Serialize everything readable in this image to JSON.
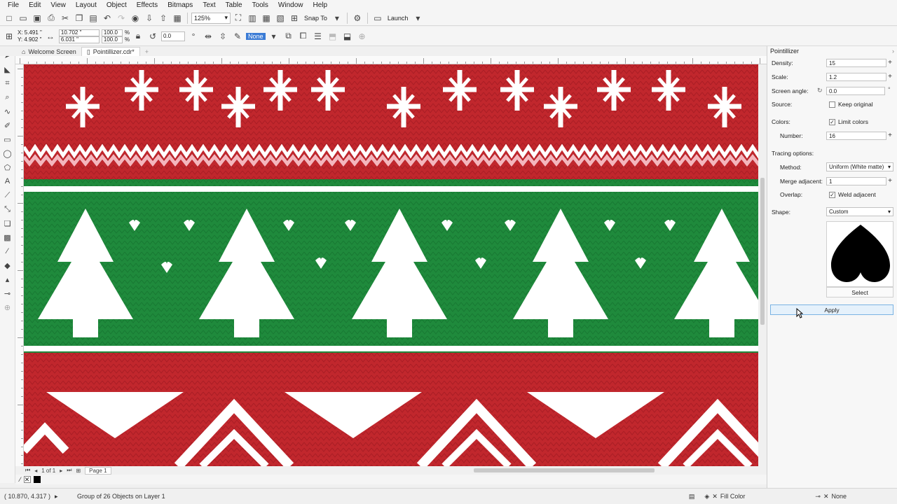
{
  "menu": [
    "File",
    "Edit",
    "View",
    "Layout",
    "Object",
    "Effects",
    "Bitmaps",
    "Text",
    "Table",
    "Tools",
    "Window",
    "Help"
  ],
  "toolbar": {
    "zoom": "125%",
    "snap": "Snap To",
    "launch": "Launch"
  },
  "propbar": {
    "x": "5.491 \"",
    "y": "4.902 \"",
    "w": "10.702 \"",
    "h": "6.031 \"",
    "sx": "100.0",
    "sy": "100.0",
    "pct": "%",
    "angle": "0.0",
    "outline": "None"
  },
  "tabs": [
    {
      "label": "Welcome Screen",
      "icon": "home-icon"
    },
    {
      "label": "Pointillizer.cdr*",
      "icon": "document-icon"
    }
  ],
  "pagenav": {
    "counter": "1 of 1",
    "page": "Page 1"
  },
  "status": {
    "coords": "( 10.870, 4.317 )",
    "info": "Group of 26 Objects on Layer 1",
    "fill": "Fill Color",
    "outline": "None"
  },
  "docker": {
    "title": "Pointillizer",
    "density_label": "Density:",
    "density": "15",
    "scale_label": "Scale:",
    "scale": "1.2",
    "angle_label": "Screen angle:",
    "angle": "0.0",
    "source_label": "Source:",
    "keep_original": "Keep original",
    "colors_label": "Colors:",
    "limit_colors": "Limit colors",
    "number_label": "Number:",
    "number": "16",
    "tracing_label": "Tracing options:",
    "method_label": "Method:",
    "method": "Uniform (White matte)",
    "merge_label": "Merge adjacent:",
    "merge": "1",
    "overlap_label": "Overlap:",
    "weld": "Weld adjacent",
    "shape_label": "Shape:",
    "shape": "Custom",
    "select": "Select",
    "apply": "Apply"
  },
  "colors": {
    "red": "#c1272d",
    "green": "#1f8a3c",
    "white": "#ffffff",
    "pink": "#f4b6bd"
  }
}
